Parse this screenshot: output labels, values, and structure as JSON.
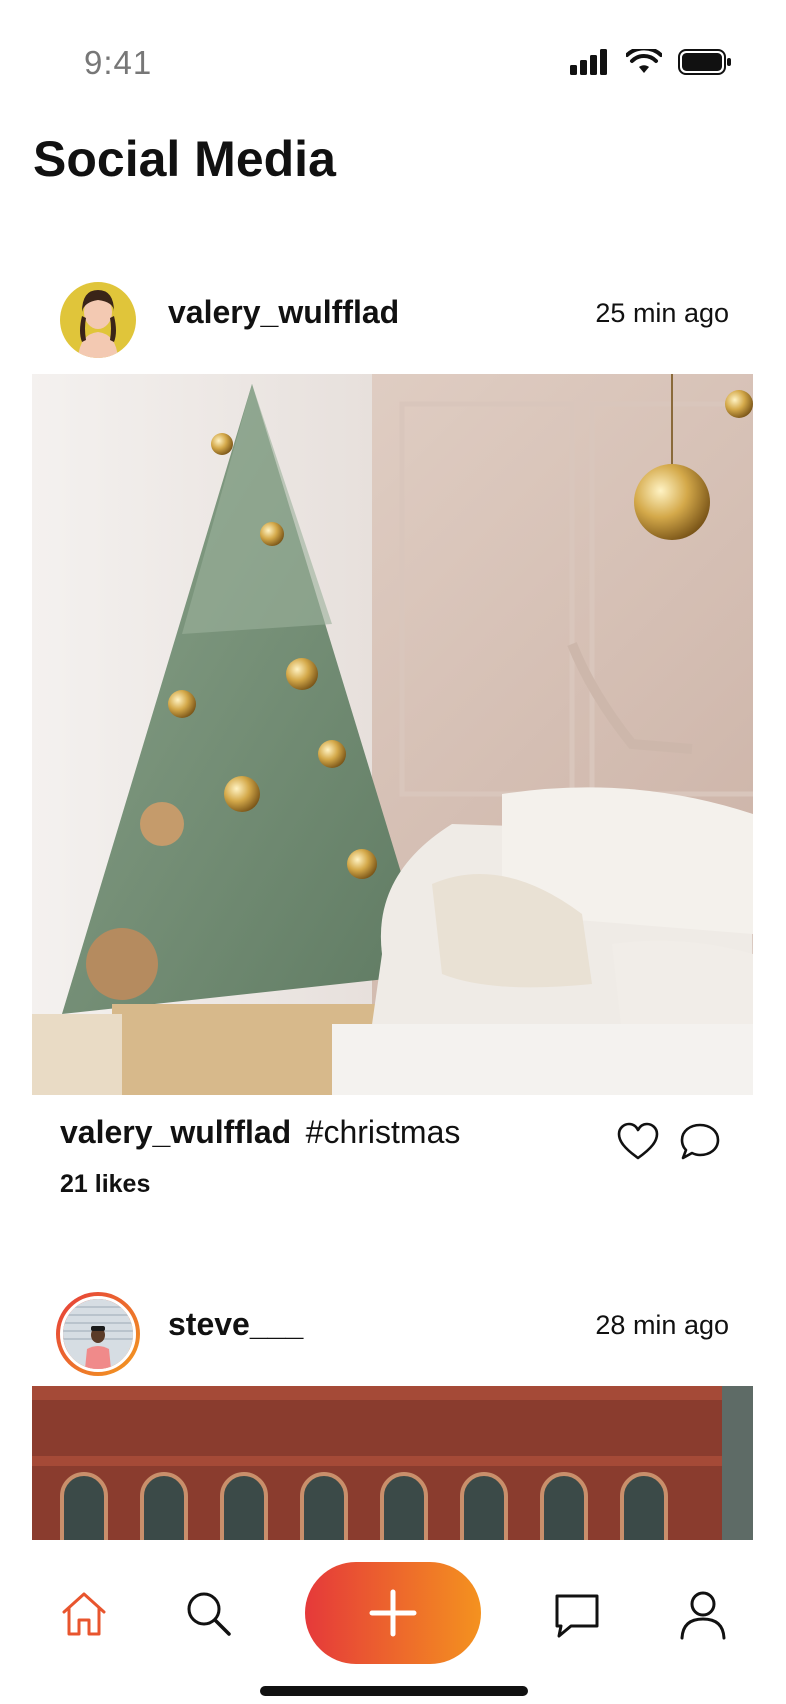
{
  "status_bar": {
    "time": "9:41"
  },
  "page": {
    "title": "Social Media"
  },
  "posts": [
    {
      "username": "valery_wulfflad",
      "time_ago": "25 min ago",
      "caption_user": "valery_wulfflad",
      "caption_text": "#christmas",
      "likes": "21 likes",
      "image_subject": "christmas-tree-living-room"
    },
    {
      "username": "steve___",
      "time_ago": "28 min ago",
      "image_subject": "brick-building-facade"
    }
  ],
  "tab_bar": {
    "items": [
      "home-icon",
      "search-icon",
      "add-icon",
      "message-icon",
      "profile-icon"
    ],
    "active": "home-icon",
    "accent_start": "#e5393a",
    "accent_end": "#f4921f"
  }
}
